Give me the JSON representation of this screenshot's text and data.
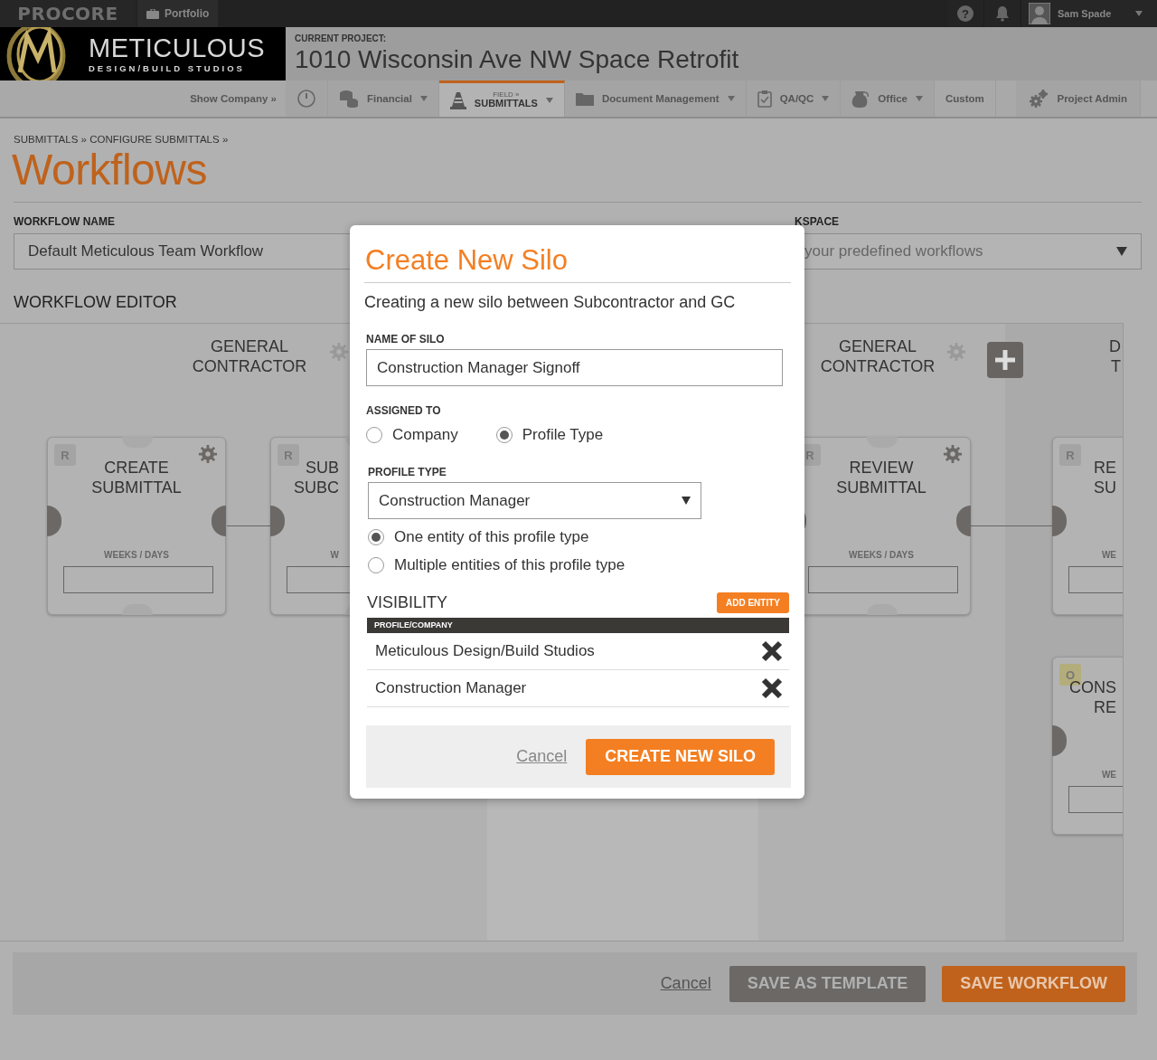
{
  "top_bar": {
    "logo": "PROCORE",
    "portfolio": "Portfolio",
    "help": "?",
    "user": "Sam Spade"
  },
  "company": {
    "name": "METICULOUS",
    "tagline": "DESIGN/BUILD STUDIOS"
  },
  "project": {
    "label": "CURRENT PROJECT:",
    "name": "1010 Wisconsin Ave NW Space Retrofit"
  },
  "nav": [
    {
      "kind": "text",
      "label": "Show Company »",
      "dropdown": false,
      "selected": false
    },
    {
      "kind": "icon",
      "dropdown": false,
      "selected": false
    },
    {
      "kind": "menu",
      "label": "Financial",
      "dropdown": true,
      "selected": false
    },
    {
      "kind": "section",
      "section": "FIELD »",
      "label": "SUBMITTALS",
      "dropdown": true,
      "selected": true
    },
    {
      "kind": "menu",
      "label": "Document Management",
      "dropdown": true,
      "selected": false
    },
    {
      "kind": "menu",
      "label": "QA/QC",
      "dropdown": true,
      "selected": false
    },
    {
      "kind": "menu",
      "label": "Office",
      "dropdown": true,
      "selected": false
    },
    {
      "kind": "text",
      "label": "Custom",
      "dropdown": false,
      "selected": false
    },
    {
      "kind": "admin",
      "label": "Project Admin",
      "dropdown": false,
      "selected": false
    }
  ],
  "breadcrumb": "SUBMITTALS » CONFIGURE SUBMITTALS »",
  "page_title": "Workflows",
  "workflow_name": {
    "label": "WORKFLOW NAME",
    "value": "Default Meticulous Team Workflow"
  },
  "based_on": {
    "label": "KSPACE",
    "placeholder": "your predefined workflows"
  },
  "editor": {
    "title": "WORKFLOW EDITOR",
    "columns": [
      {
        "heading": [
          "GENERAL",
          "CONTRACTOR"
        ],
        "settings": true,
        "add": false
      },
      {
        "heading": [
          "GENERAL",
          "CONTRACTOR"
        ],
        "settings": true,
        "add": true
      },
      {
        "heading": [
          "D",
          "T"
        ],
        "settings": false,
        "add": false
      }
    ],
    "cards": [
      {
        "badge": "R",
        "color": "#a4a4a4",
        "title": [
          "CREATE",
          "SUBMITTAL"
        ],
        "duration_label": "WEEKS / DAYS",
        "settings": true
      },
      {
        "badge": "R",
        "color": "#a4a4a4",
        "title": [
          "SUB",
          "SUBC"
        ],
        "duration_label": "W",
        "settings": false
      },
      {
        "badge": "R",
        "color": "#a4a4a4",
        "title": [
          "REVIEW",
          "SUBMITTAL"
        ],
        "duration_label": "WEEKS / DAYS",
        "settings": true
      },
      {
        "badge": "R",
        "color": "#a4a4a4",
        "title": [
          "RE",
          "SU"
        ],
        "duration_label": "WE",
        "settings": false
      },
      {
        "badge": "O",
        "color": "#b3ad7b",
        "title": [
          "CONS",
          "RE"
        ],
        "duration_label": "WE",
        "settings": false
      }
    ]
  },
  "modal": {
    "title": "Create New Silo",
    "description": "Creating a new silo between Subcontractor and GC",
    "name_label": "NAME OF SILO",
    "name_value": "Construction Manager Signoff",
    "assigned_label": "ASSIGNED TO",
    "assigned_options": [
      {
        "label": "Company",
        "selected": false
      },
      {
        "label": "Profile Type",
        "selected": true
      }
    ],
    "profile_label": "PROFILE TYPE",
    "profile_value": "Construction Manager",
    "entity_options": [
      {
        "label": "One entity of this profile type",
        "selected": true
      },
      {
        "label": "Multiple entities of this profile type",
        "selected": false
      }
    ],
    "visibility_title": "VISIBILITY",
    "add_entity": "ADD ENTITY",
    "visibility_header": "PROFILE/COMPANY",
    "visibility_rows": [
      "Meticulous Design/Build Studios",
      "Construction Manager"
    ],
    "cancel": "Cancel",
    "submit": "CREATE NEW SILO"
  },
  "footer": {
    "cancel": "Cancel",
    "buttons": [
      {
        "label": "SAVE AS TEMPLATE",
        "kind": "secondary"
      },
      {
        "label": "SAVE WORKFLOW",
        "kind": "primary"
      }
    ]
  }
}
